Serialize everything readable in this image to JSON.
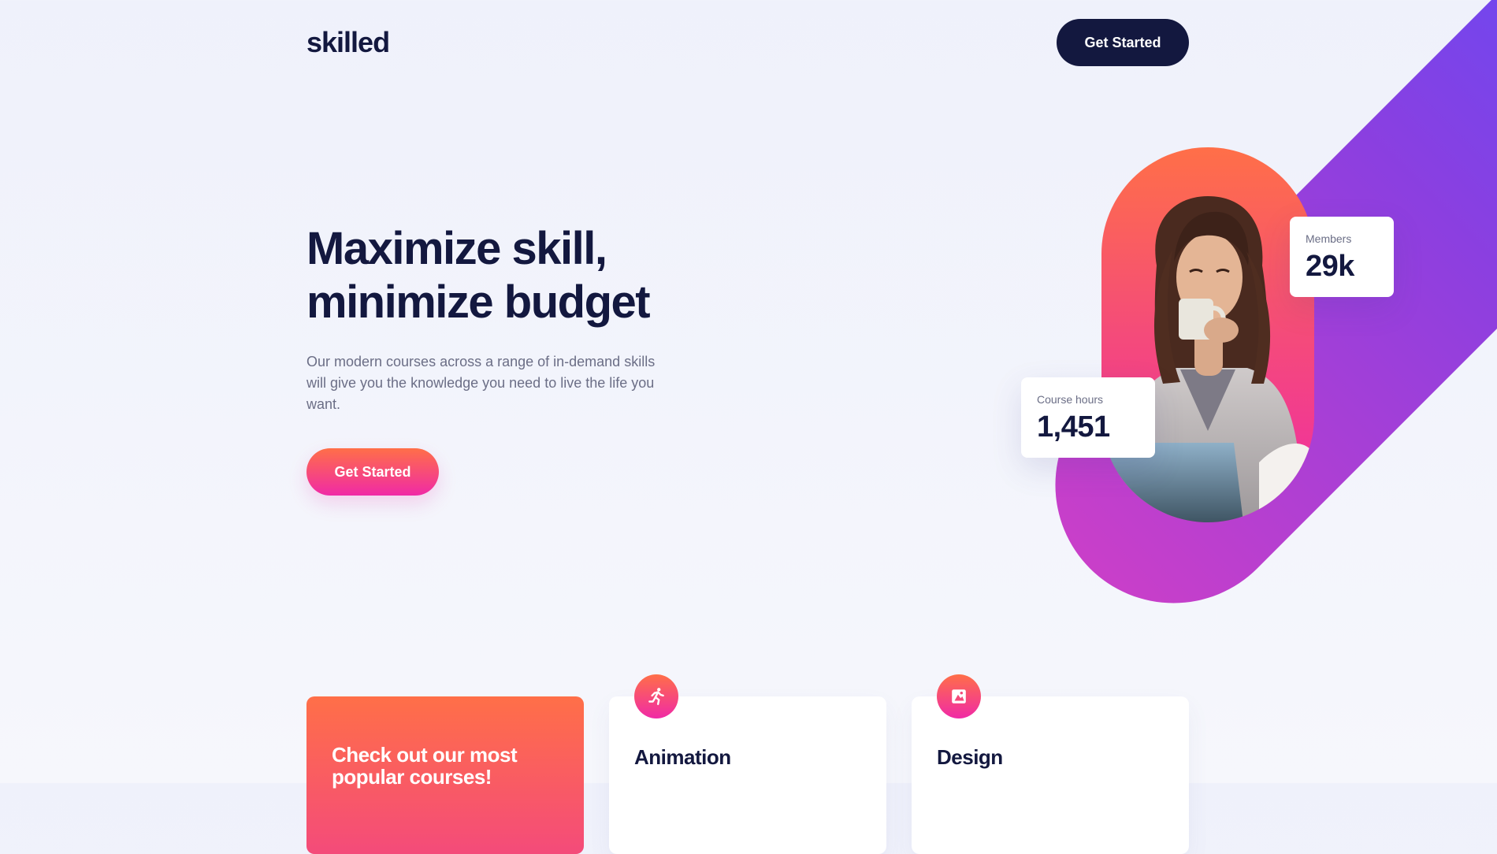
{
  "header": {
    "logo": "skilled",
    "cta_label": "Get Started"
  },
  "hero": {
    "title_line1": "Maximize skill,",
    "title_line2": "minimize budget",
    "description": "Our modern courses across a range of in-demand skills will give you the knowledge you need to live the life you want.",
    "cta_label": "Get Started"
  },
  "stats": {
    "members": {
      "label": "Members",
      "value": "29k"
    },
    "course_hours": {
      "label": "Course hours",
      "value": "1,451"
    }
  },
  "courses": {
    "promo_text": "Check out our most popular courses!",
    "items": [
      {
        "title": "Animation",
        "icon": "running-person-icon"
      },
      {
        "title": "Design",
        "icon": "design-image-icon"
      }
    ]
  },
  "colors": {
    "navy": "#13183f",
    "coral": "#ff6f48",
    "pink": "#f02aa6",
    "violet": "#5a4dfb"
  }
}
